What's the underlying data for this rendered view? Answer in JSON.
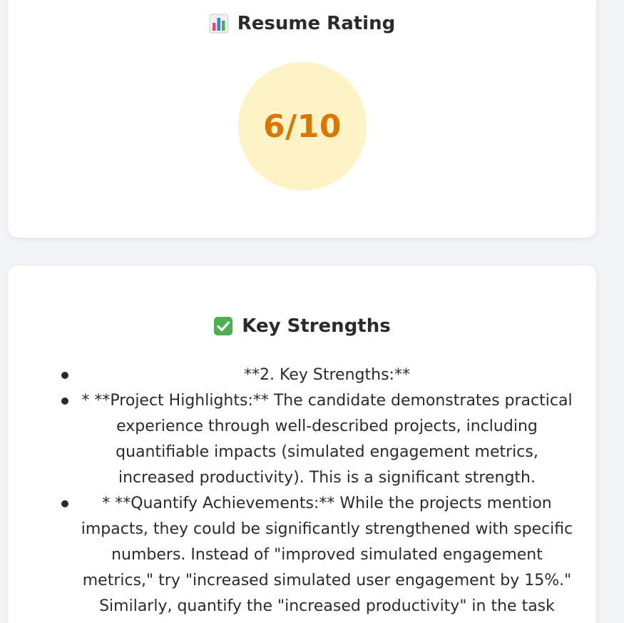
{
  "rating_card": {
    "title": "Resume Rating",
    "icon": "bar-chart-icon",
    "score": "6/10",
    "score_color": "#d97706",
    "circle_color": "#fef3c7"
  },
  "strengths_card": {
    "title": "Key Strengths",
    "icon": "check-box-icon",
    "items": [
      "**2. Key Strengths:**",
      "* **Project Highlights:** The candidate demonstrates practical experience through well-described projects, including quantifiable impacts (simulated engagement metrics, increased productivity). This is a significant strength.",
      "* **Quantify Achievements:** While the projects mention impacts, they could be significantly strengthened with specific numbers. Instead of \"improved simulated engagement metrics,\" try \"increased simulated user engagement by 15%.\" Similarly, quantify the \"increased productivity\" in the task manager project."
    ]
  }
}
